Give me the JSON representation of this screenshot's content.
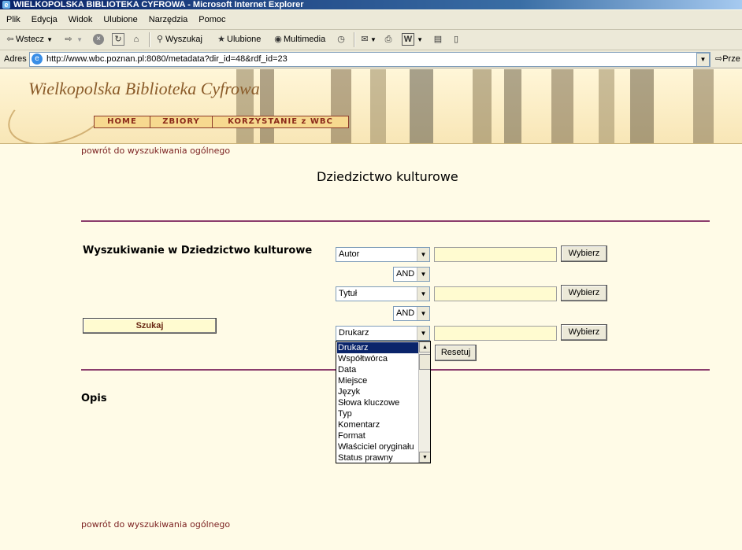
{
  "window": {
    "title": "WIELKOPOLSKA BIBLIOTEKA CYFROWA - Microsoft Internet Explorer"
  },
  "menu": [
    "Plik",
    "Edycja",
    "Widok",
    "Ulubione",
    "Narzędzia",
    "Pomoc"
  ],
  "toolbar": {
    "back": "Wstecz",
    "search": "Wyszukaj",
    "favorites": "Ulubione",
    "media": "Multimedia"
  },
  "address": {
    "label": "Adres",
    "url": "http://www.wbc.poznan.pl:8080/metadata?dir_id=48&rdf_id=23",
    "go": "Prze"
  },
  "banner": {
    "title": "Wielkopolska Biblioteka Cyfrowa",
    "nav": [
      "HOME",
      "ZBIORY",
      "KORZYSTANIE z WBC"
    ]
  },
  "content": {
    "back_link": "powrót do wyszukiwania ogólnego",
    "page_title": "Dziedzictwo kulturowe",
    "search_heading": "Wyszukiwanie w Dziedzictwo kulturowe",
    "search_button": "Szukaj",
    "rows": [
      {
        "field": "Autor",
        "value": "",
        "choose": "Wybierz"
      },
      {
        "field": "Tytuł",
        "value": "",
        "choose": "Wybierz"
      },
      {
        "field": "Drukarz",
        "value": "",
        "choose": "Wybierz"
      }
    ],
    "operators": [
      "AND",
      "AND"
    ],
    "reset": "Resetuj",
    "dropdown_options": [
      "Drukarz",
      "Współtwórca",
      "Data",
      "Miejsce",
      "Język",
      "Słowa kluczowe",
      "Typ",
      "Komentarz",
      "Format",
      "Właściciel oryginału",
      "Status prawny"
    ],
    "dropdown_selected": "Drukarz",
    "description_heading": "Opis"
  }
}
